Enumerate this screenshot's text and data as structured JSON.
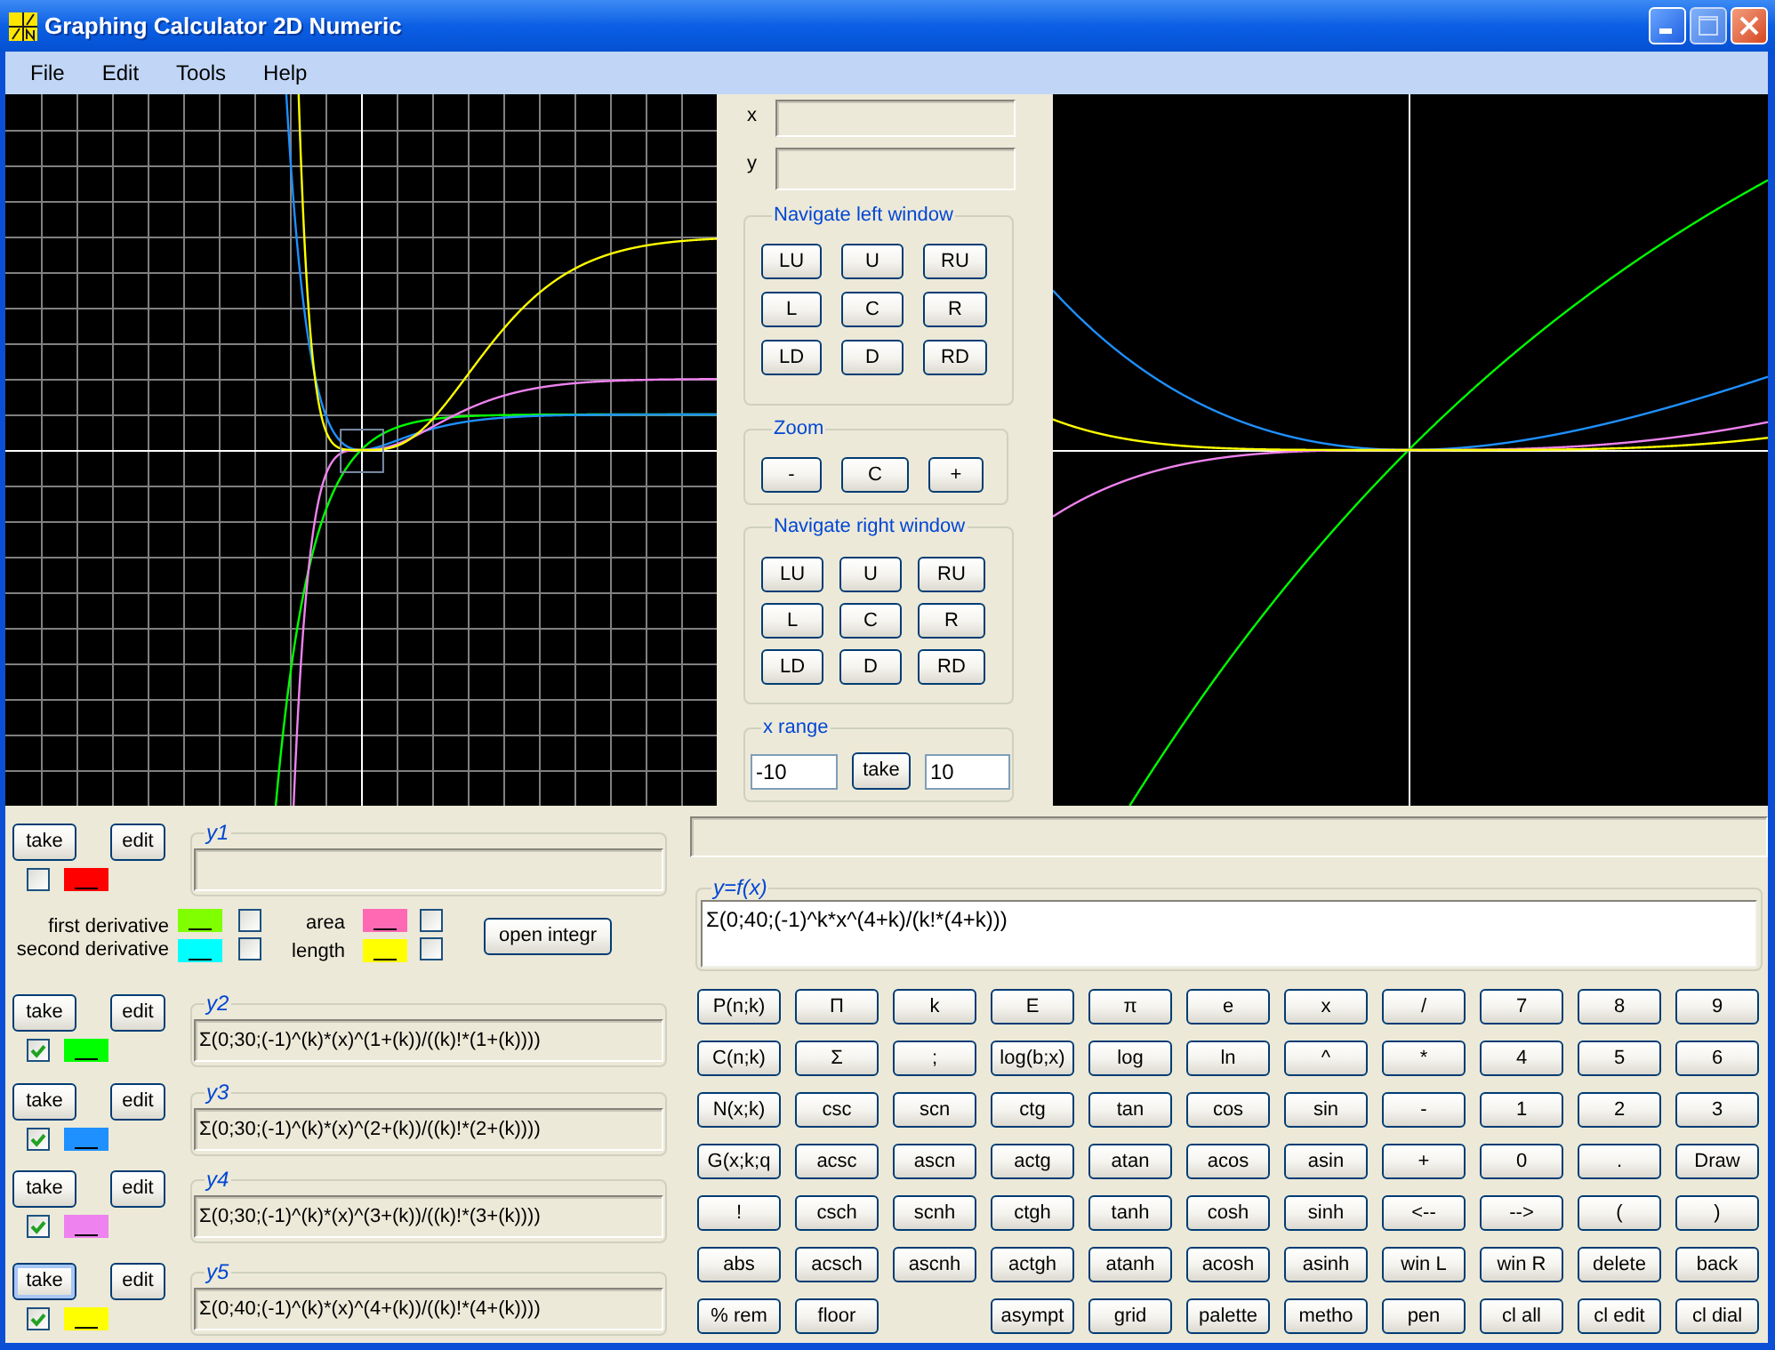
{
  "window": {
    "title": "Graphing Calculator 2D Numeric"
  },
  "menu": [
    "File",
    "Edit",
    "Tools",
    "Help"
  ],
  "left_graph": {
    "grid": true
  },
  "right_graph": {
    "grid": false
  },
  "coordinates": [
    {
      "label": "x"
    },
    {
      "label": "y"
    }
  ],
  "navigate_left": {
    "title": "Navigate left window",
    "buttons": [
      "LU",
      "U",
      "RU",
      "L",
      "C",
      "R",
      "LD",
      "D",
      "RD"
    ]
  },
  "zoom": {
    "title": "Zoom",
    "buttons": [
      "-",
      "C",
      "+"
    ]
  },
  "navigate_right": {
    "title": "Navigate right window",
    "buttons": [
      "LU",
      "U",
      "RU",
      "L",
      "C",
      "R",
      "LD",
      "D",
      "RD"
    ]
  },
  "x_range": {
    "title": "x range",
    "from": "-10",
    "button": "take",
    "to": "10"
  },
  "functions": [
    {
      "name": "y1",
      "take": "take",
      "edit": "edit",
      "checked": false,
      "color": "#ff0000",
      "take_focused": false
    },
    {
      "name": "y2",
      "take": "take",
      "edit": "edit",
      "checked": true,
      "color": "#00ff00",
      "take_focused": false,
      "formula": "Σ(0;30;(-1)^(k)*(x)^(1+(k))/((k)!*(1+(k))))"
    },
    {
      "name": "y3",
      "take": "take",
      "edit": "edit",
      "checked": true,
      "color": "#1e90ff",
      "take_focused": false,
      "formula": "Σ(0;30;(-1)^(k)*(x)^(2+(k))/((k)!*(2+(k))))"
    },
    {
      "name": "y4",
      "take": "take",
      "edit": "edit",
      "checked": true,
      "color": "#ee82ee",
      "take_focused": false,
      "formula": "Σ(0;30;(-1)^(k)*(x)^(3+(k))/((k)!*(3+(k))))"
    },
    {
      "name": "y5",
      "take": "take",
      "edit": "edit",
      "checked": true,
      "color": "#ffff00",
      "take_focused": true,
      "formula": "Σ(0;40;(-1)^(k)*(x)^(4+(k))/((k)!*(4+(k))))"
    }
  ],
  "derivative_options": [
    {
      "label": "first derivative",
      "color": "#80ff00",
      "checked": false
    },
    {
      "label": "second derivative",
      "color": "#00ffff",
      "checked": false
    }
  ],
  "integral_options": [
    {
      "label": "area",
      "color": "#ff69b4",
      "checked": false
    },
    {
      "label": "length",
      "color": "#ffff00",
      "checked": false
    }
  ],
  "open_integral_button": "open integr",
  "editor": {
    "title": "y=f(x)",
    "value": "Σ(0;40;(-1)^k*x^(4+k)/(k!*(4+k)))"
  },
  "keypad": {
    "rows": [
      [
        "P(n;k)",
        "Π",
        "k",
        "E",
        "π",
        "e",
        "x",
        "/",
        "7",
        "8",
        "9"
      ],
      [
        "C(n;k)",
        "Σ",
        ";",
        "log(b;x)",
        "log",
        "ln",
        "^",
        "*",
        "4",
        "5",
        "6"
      ],
      [
        "N(x;k)",
        "csc",
        "scn",
        "ctg",
        "tan",
        "cos",
        "sin",
        "-",
        "1",
        "2",
        "3"
      ],
      [
        "G(x;k;q",
        "acsc",
        "ascn",
        "actg",
        "atan",
        "acos",
        "asin",
        "+",
        "0",
        ".",
        "Draw"
      ],
      [
        "!",
        "csch",
        "scnh",
        "ctgh",
        "tanh",
        "cosh",
        "sinh",
        "<--",
        "-->",
        "(",
        ")"
      ],
      [
        "abs",
        "acsch",
        "ascnh",
        "actgh",
        "atanh",
        "acosh",
        "asinh",
        "win L",
        "win R",
        "delete",
        "back"
      ]
    ],
    "last_row_left": [
      "% rem",
      "floor"
    ],
    "last_row_right": [
      "asympt",
      "grid",
      "palette",
      "metho",
      "pen",
      "cl all",
      "cl edit",
      "cl dial"
    ]
  }
}
